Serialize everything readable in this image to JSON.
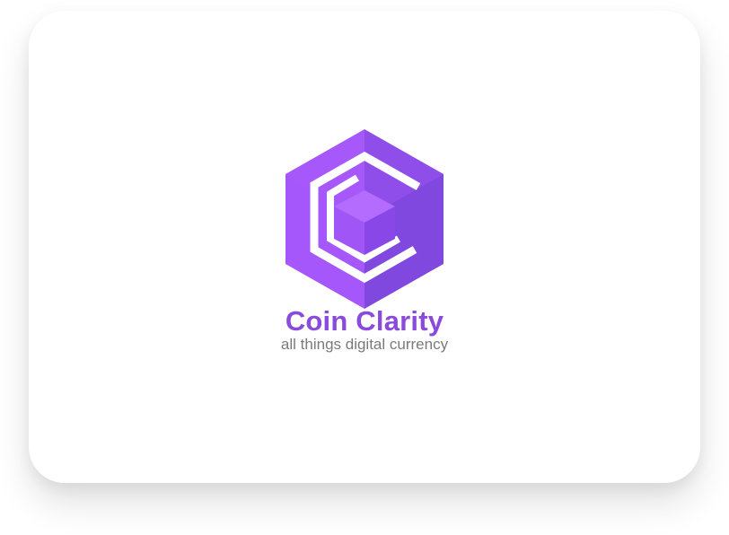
{
  "brand": {
    "name": "Coin Clarity",
    "tagline": "all things digital currency"
  },
  "colors": {
    "background": "#ffffff",
    "brand_purple": "#8a4bdc",
    "hex_left": "#a557fb",
    "hex_right": "#8148e0",
    "inner_cube_top": "#b46bff",
    "inner_cube_left": "#a055f7",
    "inner_cube_right": "#8a47e8",
    "tagline_gray": "#7a7a7a"
  },
  "logo": {
    "icon": "hexagon-cube-c-logo-icon"
  }
}
